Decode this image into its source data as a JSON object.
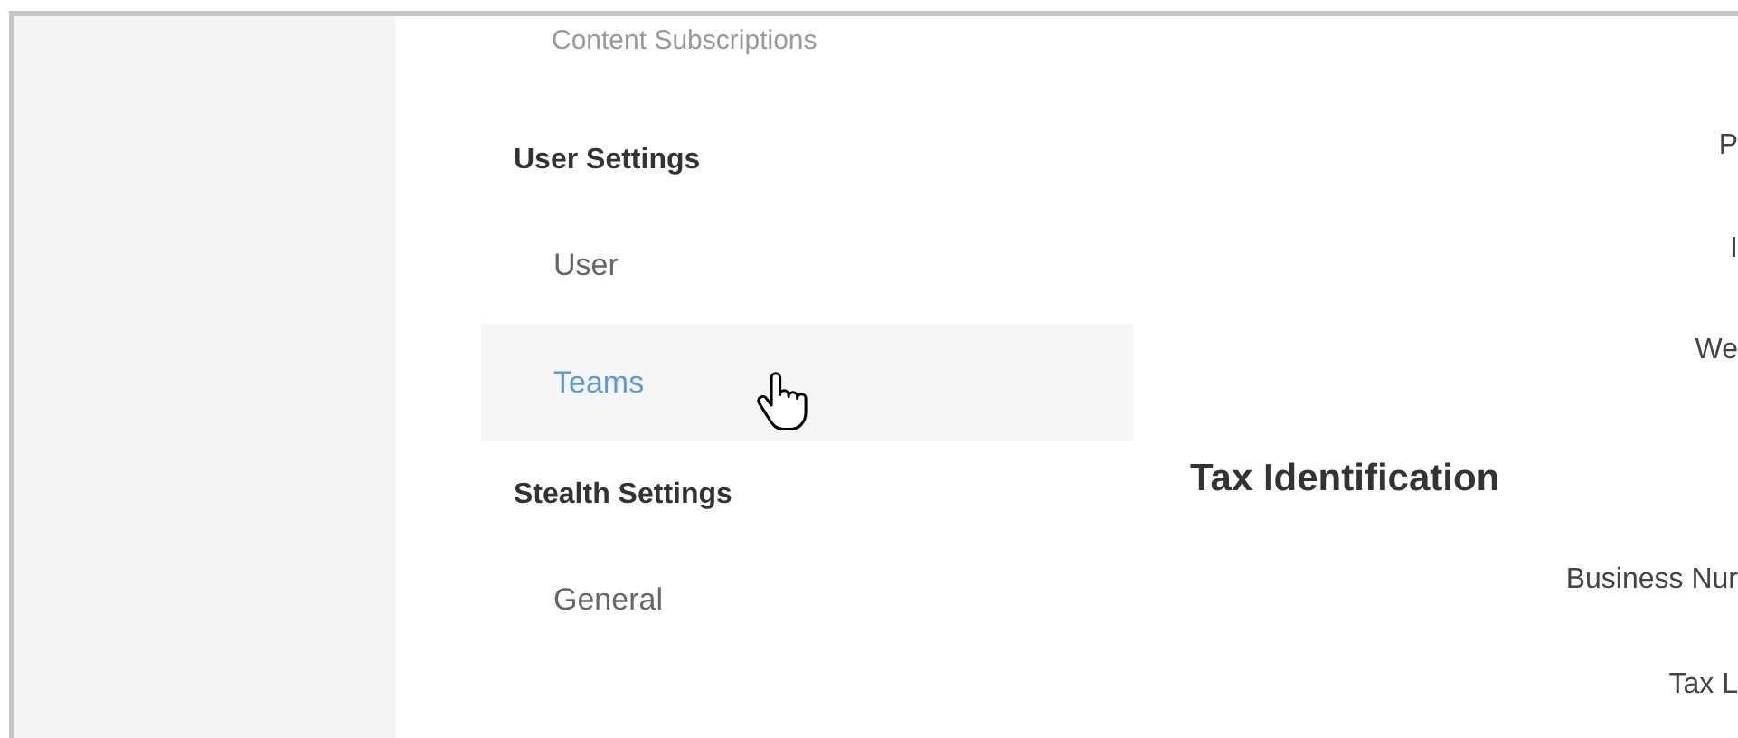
{
  "sidebar": {
    "cut_item": "Content Subscriptions",
    "groups": [
      {
        "heading": "User Settings",
        "items": [
          {
            "label": "User",
            "selected": false
          },
          {
            "label": "Teams",
            "selected": true
          }
        ]
      },
      {
        "heading": "Stealth Settings",
        "items": [
          {
            "label": "General",
            "selected": false
          }
        ]
      }
    ]
  },
  "content": {
    "top_labels": [
      "P",
      "I",
      "We"
    ],
    "section": {
      "title": "Tax Identification",
      "labels": [
        "Business Nur",
        "Tax L"
      ]
    }
  }
}
